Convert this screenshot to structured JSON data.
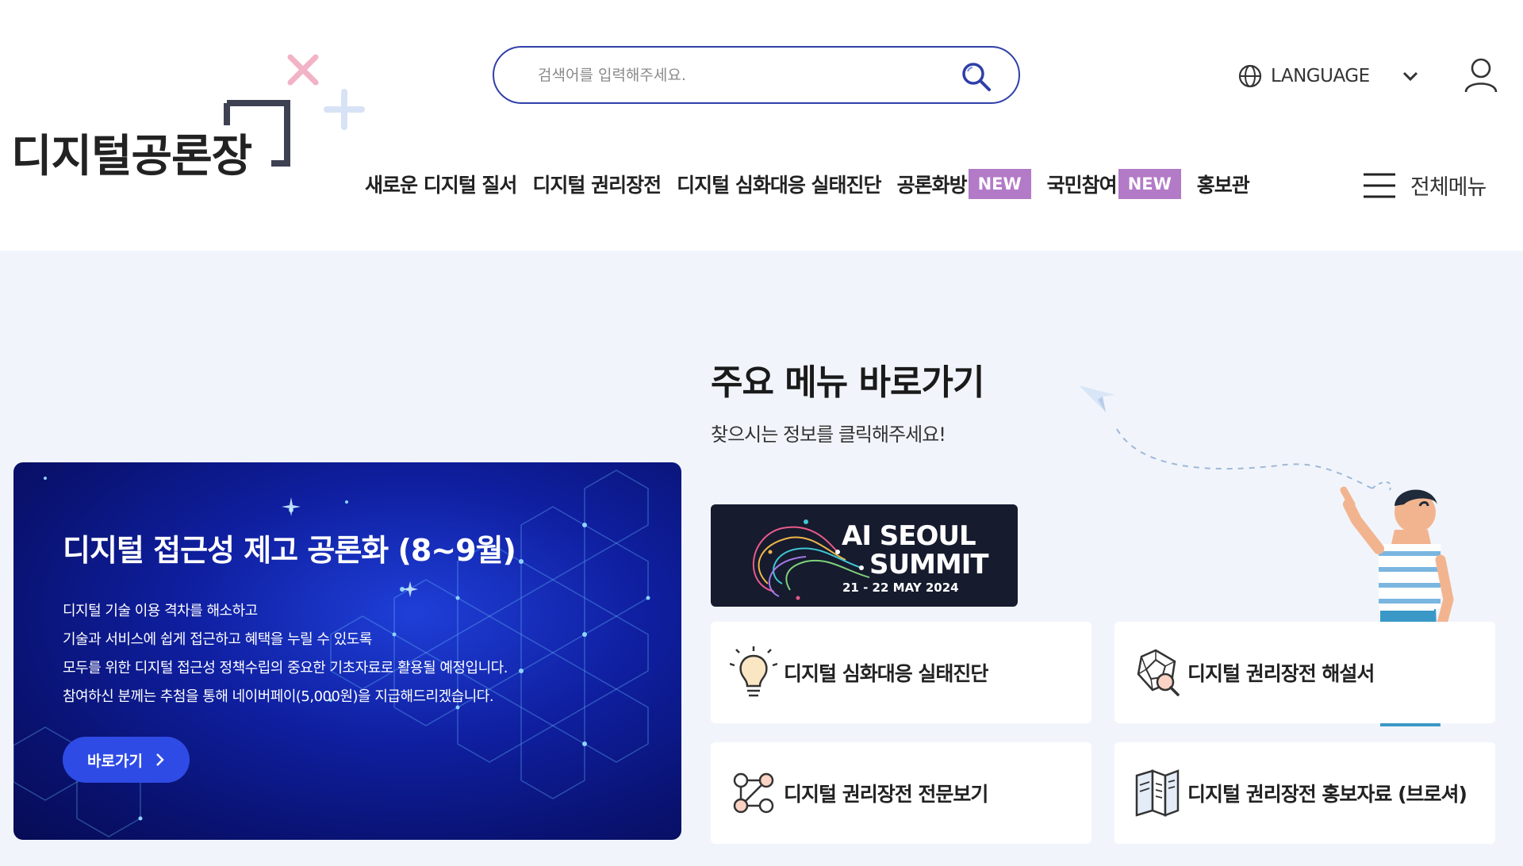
{
  "logo": {
    "text": "디지털공론장"
  },
  "search": {
    "placeholder": "검색어를 입력해주세요."
  },
  "language": {
    "label": "LANGUAGE"
  },
  "gnb": {
    "items": [
      {
        "label": "새로운 디지털 질서"
      },
      {
        "label": "디지털 권리장전"
      },
      {
        "label": "디지털 심화대응 실태진단"
      },
      {
        "label": "공론화방",
        "badge": "NEW"
      },
      {
        "label": "국민참여",
        "badge": "NEW"
      },
      {
        "label": "홍보관"
      }
    ],
    "all_menu": "전체메뉴"
  },
  "banner": {
    "title": "디지털 접근성 제고 공론화 (8~9월)",
    "desc": [
      "디지털 기술 이용 격차를 해소하고",
      "기술과 서비스에 쉽게 접근하고 혜택을 누릴 수 있도록",
      "모두를 위한 디지털 접근성 정책수립의 중요한 기초자료로 활용될 예정입니다.",
      "참여하신 분께는 추첨을 통해 네이버페이(5,000원)을 지급해드리겠습니다."
    ],
    "button": "바로가기"
  },
  "quick": {
    "title": "주요 메뉴 바로가기",
    "subtitle": "찾으시는 정보를 클릭해주세요!",
    "summit": {
      "line1": "AI SEOUL",
      "line2": "SUMMIT",
      "date": "21 - 22 MAY 2024"
    },
    "cards": [
      {
        "label": "디지털 심화대응 실태진단",
        "icon": "lightbulb-icon"
      },
      {
        "label": "디지털 권리장전 해설서",
        "icon": "analysis-icon"
      },
      {
        "label": "디지털 권리장전 전문보기",
        "icon": "network-icon"
      },
      {
        "label": "디지털 권리장전 홍보자료 (브로셔)",
        "icon": "brochure-icon"
      }
    ]
  },
  "colors": {
    "accent": "#2f3fa8",
    "badge": "#b37ac7",
    "banner_button": "#2f4be6",
    "main_bg": "#f1f5fb"
  }
}
